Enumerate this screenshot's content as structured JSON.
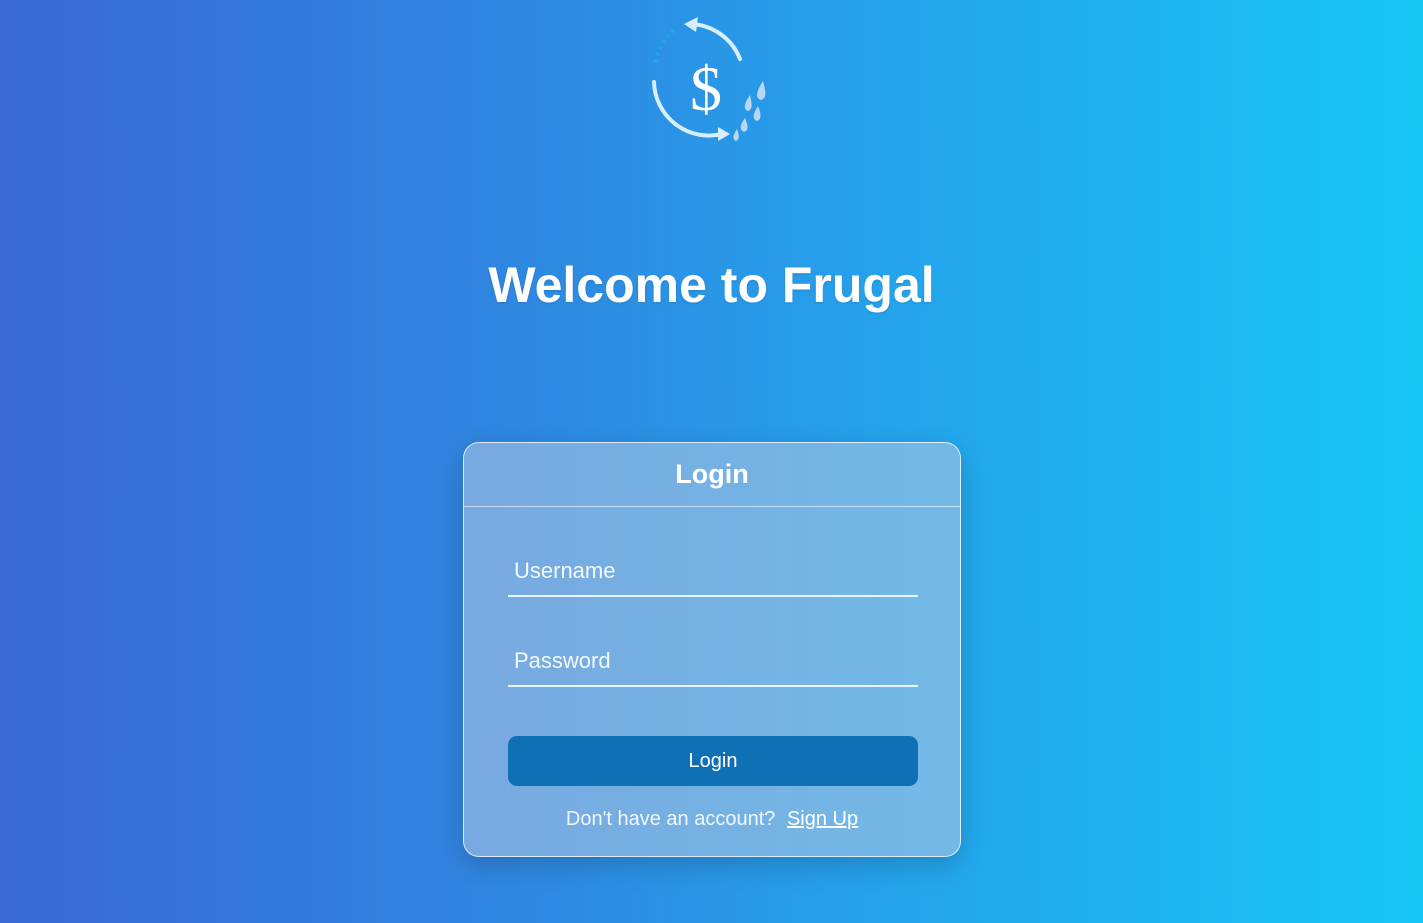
{
  "logo": {
    "icon": "dollar-cycle-logo",
    "symbol": "$"
  },
  "header": {
    "title": "Welcome to Frugal"
  },
  "login_card": {
    "title": "Login",
    "username_placeholder": "Username",
    "password_placeholder": "Password",
    "button_label": "Login",
    "signup_prompt": "Don't have an account?",
    "signup_link": "Sign Up"
  },
  "colors": {
    "background_start": "#3a69d2",
    "background_end": "#17c6f4",
    "button": "#1070b5"
  }
}
